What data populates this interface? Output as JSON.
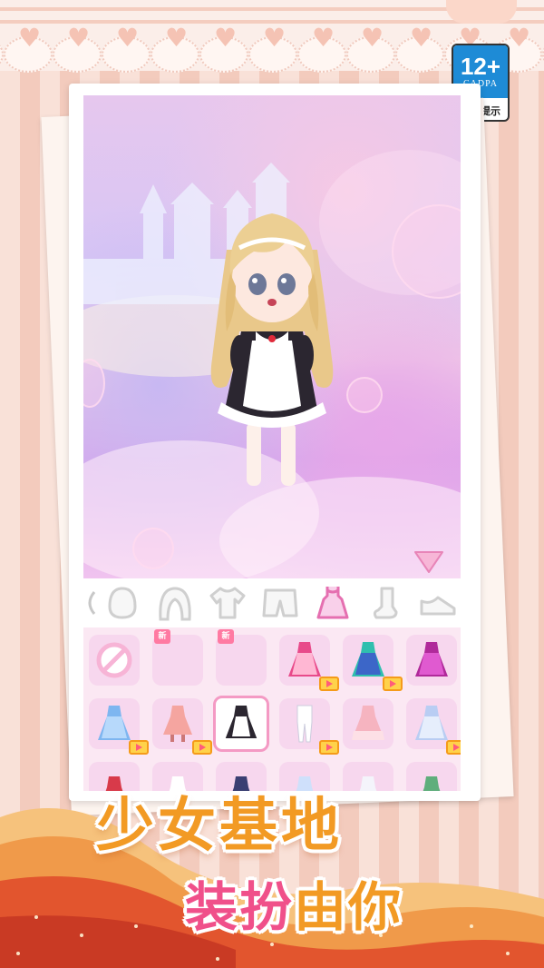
{
  "age_rating": {
    "rating": "12+",
    "org": "CADPA",
    "tip": "适龄提示"
  },
  "categories": [
    {
      "name": "face",
      "label": ""
    },
    {
      "name": "hair",
      "label": ""
    },
    {
      "name": "top",
      "label": ""
    },
    {
      "name": "pants",
      "label": ""
    },
    {
      "name": "dress",
      "label": ""
    },
    {
      "name": "socks",
      "label": ""
    },
    {
      "name": "shoes",
      "label": ""
    }
  ],
  "selected_category": "dress",
  "items": {
    "new_label": "新"
  },
  "slogan": {
    "line1": "少女基地",
    "line2_part1": "装扮",
    "line2_part2": "由你"
  },
  "colors": {
    "accent_pink": "#f49ac4",
    "slot_bg": "#f7d7ee",
    "slogan_orange": "#f29a24",
    "slogan_pink": "#f0508a",
    "badge_blue": "#1e8bd6"
  }
}
